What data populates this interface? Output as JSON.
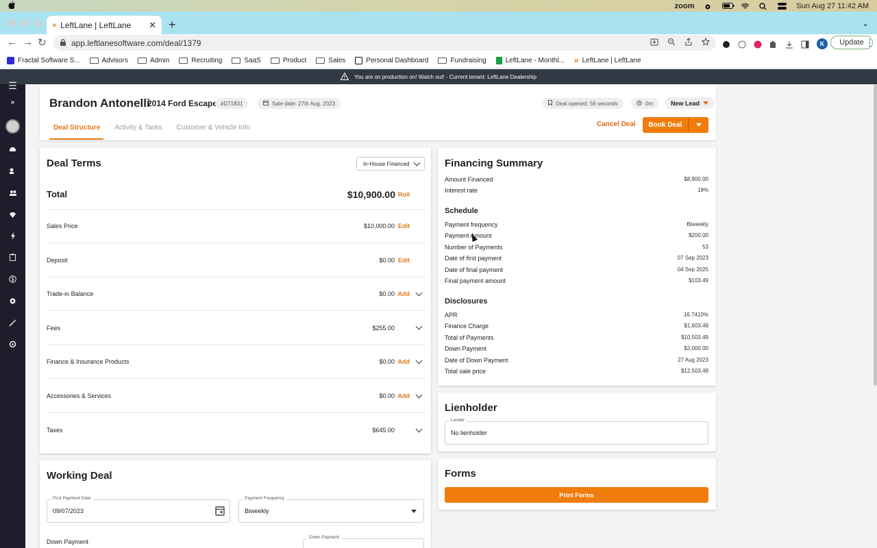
{
  "menubar": {
    "app": "zoom",
    "date_time": "Sun Aug 27  11:42 AM"
  },
  "browser": {
    "tab_title": "LeftLane | LeftLane",
    "url": "app.leftlanesoftware.com/deal/1379",
    "profile_initial": "K",
    "update_label": "Update",
    "bookmarks": [
      "Fractal Software S...",
      "Advisors",
      "Admin",
      "Recruiting",
      "SaaS",
      "Product",
      "Sales",
      "Personal Dashboard",
      "Fundraising",
      "LeftLane - Monthl...",
      "LeftLane | LeftLane"
    ]
  },
  "banner": {
    "text": "You are on production on! Watch out! - Current tenant: LeftLane Dealership"
  },
  "header": {
    "customer_name": "Brandon Antonelli",
    "vehicle": "2014 Ford Escape",
    "deal_id": "#D71831",
    "sale_date": "Sale date: 27th Aug, 2023",
    "deal_opened": "Deal opened: 56 seconds",
    "timer": "0m",
    "status": "New Lead",
    "tabs": [
      "Deal Structure",
      "Activity & Tasks",
      "Customer & Vehicle Info"
    ],
    "cancel_label": "Cancel Deal",
    "book_label": "Book Deal"
  },
  "deal_terms": {
    "title": "Deal Terms",
    "financing_type": "In-House Financed",
    "total_label": "Total",
    "total_value": "$10,900.00",
    "total_action": "Roll",
    "rows": [
      {
        "label": "Sales Price",
        "value": "$10,000.00",
        "action": "Edit"
      },
      {
        "label": "Deposit",
        "value": "$0.00",
        "action": "Edit"
      },
      {
        "label": "Trade-in Balance",
        "value": "$0.00",
        "action": "Add"
      },
      {
        "label": "Fees",
        "value": "$255.00",
        "action": ""
      },
      {
        "label": "Finance & Insurance Products",
        "value": "$0.00",
        "action": "Add"
      },
      {
        "label": "Accessories & Services",
        "value": "$0.00",
        "action": "Add"
      },
      {
        "label": "Taxes",
        "value": "$645.00",
        "action": ""
      }
    ]
  },
  "working_deal": {
    "title": "Working Deal",
    "first_payment_label": "First Payment Date",
    "first_payment_value": "09/07/2023",
    "frequency_label": "Payment Frequency",
    "frequency_value": "Biweekly",
    "down_payment_label": "Down Payment",
    "down_payment_field_label": "Down Payment"
  },
  "financing_summary": {
    "title": "Financing Summary",
    "top": [
      {
        "label": "Amount Financed",
        "value": "$8,900.00"
      },
      {
        "label": "Interest rate",
        "value": "18%"
      }
    ],
    "schedule_title": "Schedule",
    "schedule": [
      {
        "label": "Payment frequency",
        "value": "Biweekly"
      },
      {
        "label": "Payment Amount",
        "value": "$200.00"
      },
      {
        "label": "Number of Payments",
        "value": "53"
      },
      {
        "label": "Date of first payment",
        "value": "07 Sep 2023"
      },
      {
        "label": "Date of final payment",
        "value": "04 Sep 2025"
      },
      {
        "label": "Final payment amount",
        "value": "$103.49"
      }
    ],
    "disclosures_title": "Disclosures",
    "disclosures": [
      {
        "label": "APR",
        "value": "16.7410%"
      },
      {
        "label": "Finance Charge",
        "value": "$1,603.49"
      },
      {
        "label": "Total of Payments",
        "value": "$10,503.49"
      },
      {
        "label": "Down Payment",
        "value": "$2,000.00"
      },
      {
        "label": "Date of Down Payment",
        "value": "27 Aug 2023"
      },
      {
        "label": "Total sale price",
        "value": "$12,503.49"
      }
    ]
  },
  "lienholder": {
    "title": "Lienholder",
    "field_label": "Lender",
    "value": "No lienholder"
  },
  "forms": {
    "title": "Forms",
    "print_label": "Print Forms"
  }
}
